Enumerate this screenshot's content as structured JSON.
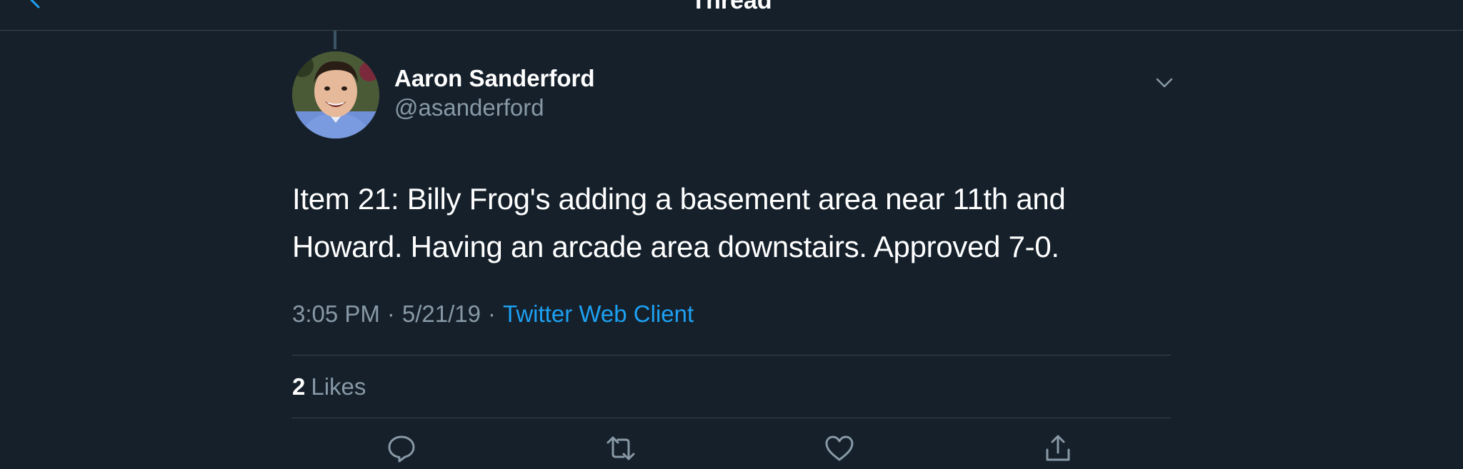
{
  "nav": {
    "title": "Thread"
  },
  "tweet": {
    "author_name": "Aaron Sanderford",
    "author_handle": "@asanderford",
    "text": "Item 21: Billy Frog's adding a basement area near 11th and Howard. Having an arcade area downstairs. Approved 7-0.",
    "time": "3:05 PM",
    "date": "5/21/19",
    "separator": "·",
    "source": "Twitter Web Client",
    "likes_count": "2",
    "likes_label": "Likes"
  },
  "icons": {
    "back": "chevron-left-icon",
    "menu": "chevron-down-icon",
    "reply": "reply-icon",
    "retweet": "retweet-icon",
    "like": "heart-icon",
    "share": "share-icon"
  },
  "colors": {
    "background": "#15202b",
    "accent": "#1da1f2",
    "secondary_text": "#8899a6",
    "primary_text": "#ffffff",
    "border": "#38444d"
  }
}
